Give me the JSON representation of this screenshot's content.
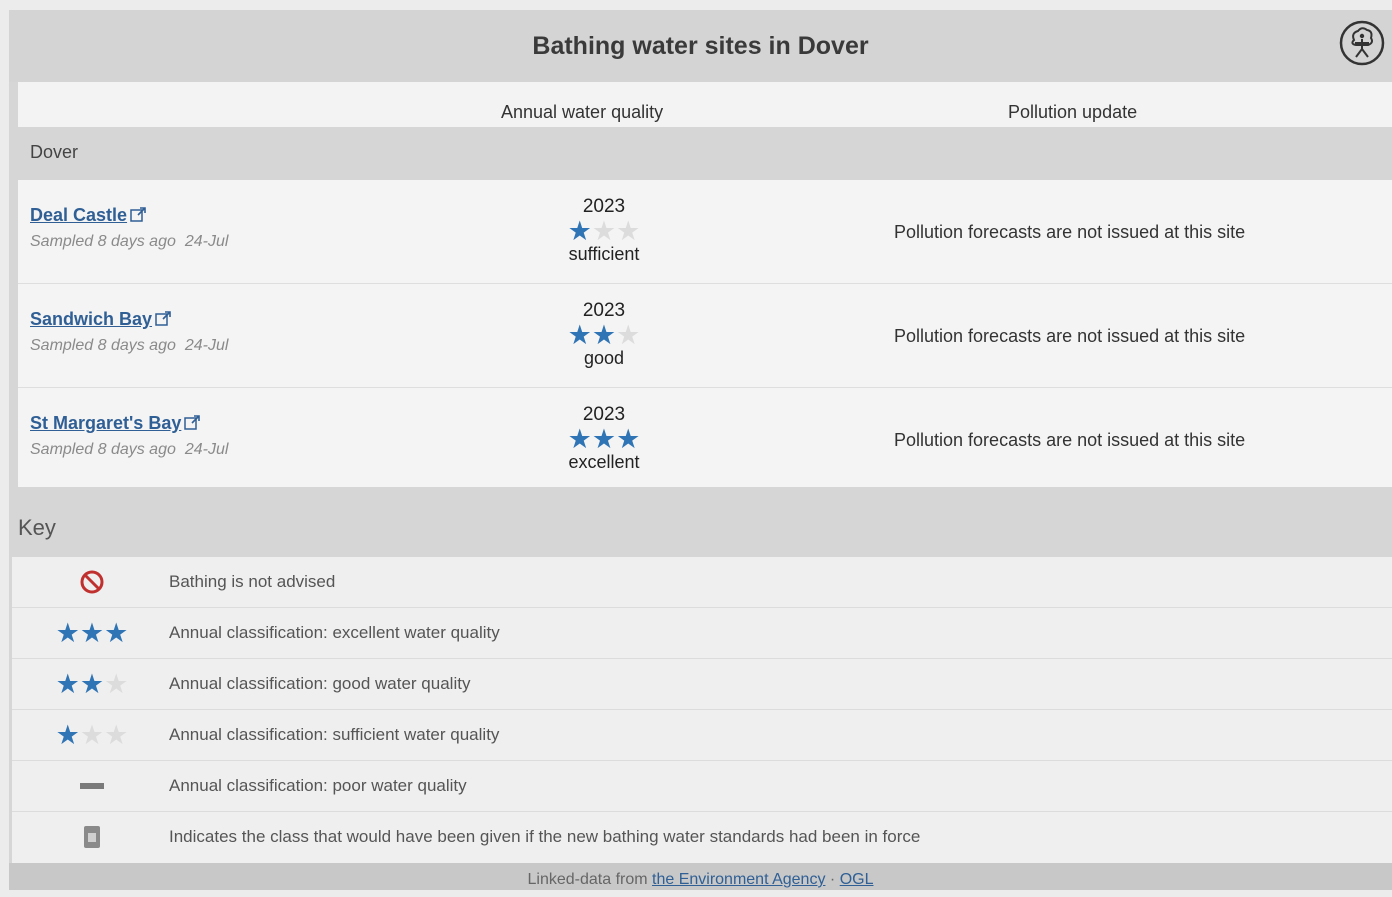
{
  "header": {
    "title": "Bathing water sites in Dover",
    "logo_icon": "tree-person-logo-icon"
  },
  "columns": {
    "quality": "Annual water quality",
    "pollution": "Pollution update"
  },
  "region": "Dover",
  "colors": {
    "link": "#2f5f95",
    "star_filled": "#2f74b5",
    "star_empty": "#dcdcdc",
    "not_advised": "#c0302f"
  },
  "sites": [
    {
      "name": "Deal Castle",
      "sampled": "Sampled 8 days ago",
      "sampled_date": "24-Jul",
      "year": "2023",
      "stars": 1,
      "rating": "sufficient",
      "pollution": "Pollution forecasts are not issued at this site"
    },
    {
      "name": "Sandwich Bay",
      "sampled": "Sampled 8 days ago",
      "sampled_date": "24-Jul",
      "year": "2023",
      "stars": 2,
      "rating": "good",
      "pollution": "Pollution forecasts are not issued at this site"
    },
    {
      "name": "St Margaret's Bay",
      "sampled": "Sampled 8 days ago",
      "sampled_date": "24-Jul",
      "year": "2023",
      "stars": 3,
      "rating": "excellent",
      "pollution": "Pollution forecasts are not issued at this site"
    }
  ],
  "key": {
    "title": "Key",
    "items": [
      {
        "icon": "no-entry-icon",
        "text": "Bathing is not advised"
      },
      {
        "icon": "three-stars-icon",
        "stars": 3,
        "text": "Annual classification: excellent water quality"
      },
      {
        "icon": "two-stars-icon",
        "stars": 2,
        "text": "Annual classification: good water quality"
      },
      {
        "icon": "one-star-icon",
        "stars": 1,
        "text": "Annual classification: sufficient water quality"
      },
      {
        "icon": "dash-icon",
        "text": "Annual classification: poor water quality"
      },
      {
        "icon": "document-icon",
        "text": "Indicates the class that would have been given if the new bathing water standards had been in force"
      }
    ]
  },
  "footer": {
    "prefix": "Linked-data from",
    "agency_link": "the Environment Agency",
    "separator": "·",
    "license_link": "OGL"
  }
}
